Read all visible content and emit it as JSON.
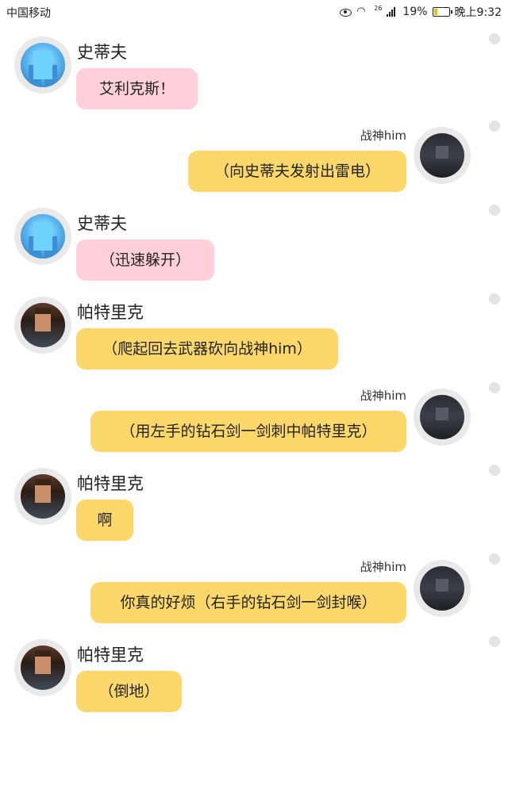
{
  "status_bar": {
    "carrier": "中国移动",
    "network_tag": "26",
    "battery": "19%",
    "time": "晚上9:32"
  },
  "messages": [
    {
      "name": "史蒂夫",
      "text": "艾利克斯！"
    },
    {
      "name": "战神him",
      "text": "（向史蒂夫发射出雷电）"
    },
    {
      "name": "史蒂夫",
      "text": "（迅速躲开）"
    },
    {
      "name": "帕特里克",
      "text": "（爬起回去武器砍向战神him）"
    },
    {
      "name": "战神him",
      "text": "（用左手的钻石剑一剑刺中帕特里克）"
    },
    {
      "name": "帕特里克",
      "text": "啊"
    },
    {
      "name": "战神him",
      "text": "你真的好烦（右手的钻石剑一剑封喉）"
    },
    {
      "name": "帕特里克",
      "text": "（倒地）"
    }
  ],
  "colors": {
    "pink_bubble": "#ffd0d9",
    "yellow_bubble": "#fcd86b"
  },
  "icons": [
    "eye-icon",
    "wifi-icon",
    "signal-icon",
    "battery-icon"
  ]
}
